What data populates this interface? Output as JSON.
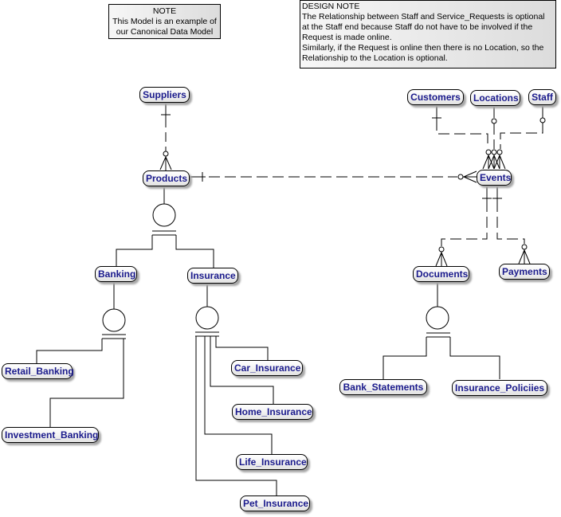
{
  "notes": {
    "note": {
      "lines": [
        "NOTE",
        "This Model is an example of",
        "our Canonical Data Model"
      ]
    },
    "design_note": {
      "lines": [
        "DESIGN NOTE",
        "The Relationship between Staff and Service_Requests is optional",
        "at the Staff end because Staff do not have to be involved if the",
        "Request is made online.",
        "Similarly, if the Request is online then there is no Location, so the",
        "Relationship to the Location is optional."
      ]
    }
  },
  "entities": {
    "suppliers": "Suppliers",
    "products": "Products",
    "banking": "Banking",
    "insurance": "Insurance",
    "retail_banking": "Retail_Banking",
    "investment_banking": "Investment_Banking",
    "car_insurance": "Car_Insurance",
    "home_insurance": "Home_Insurance",
    "life_insurance": "Life_Insurance",
    "pet_insurance": "Pet_Insurance",
    "customers": "Customers",
    "locations": "Locations",
    "staff": "Staff",
    "events": "Events",
    "documents": "Documents",
    "payments": "Payments",
    "bank_statements": "Bank_Statements",
    "insurance_policies": "Insurance_Policiies"
  },
  "colors": {
    "entity_text": "#1a1a8c",
    "line": "#000000",
    "shadow": "#a8a8a8"
  }
}
